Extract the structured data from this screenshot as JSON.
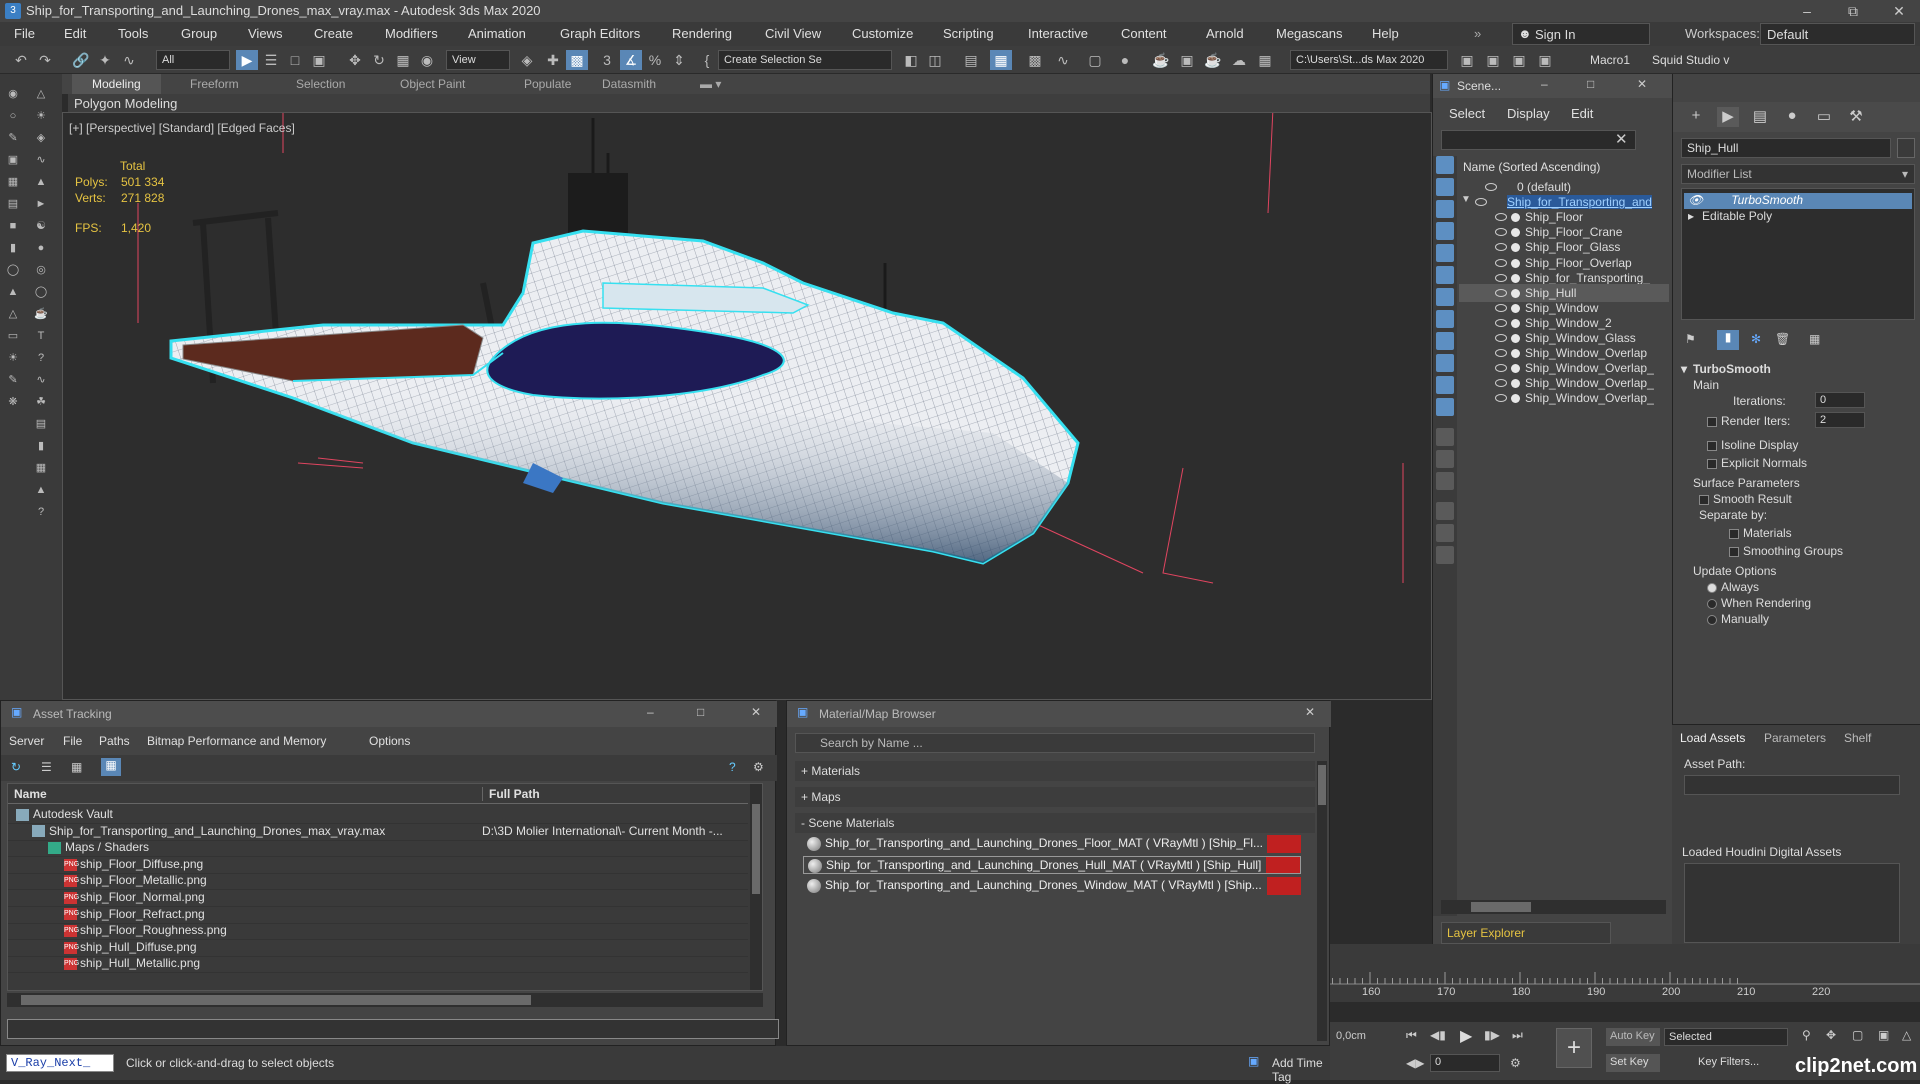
{
  "title": "Ship_for_Transporting_and_Launching_Drones_max_vray.max - Autodesk 3ds Max 2020",
  "menu": [
    "File",
    "Edit",
    "Tools",
    "Group",
    "Views",
    "Create",
    "Modifiers",
    "Animation",
    "Graph Editors",
    "Rendering",
    "Civil View",
    "Customize",
    "Scripting",
    "Interactive",
    "Content",
    "Arnold",
    "Megascans",
    "Help"
  ],
  "signin": "Sign In",
  "workspaces_label": "Workspaces:",
  "workspace": "Default",
  "toolbar": {
    "filter": "All",
    "refcoord": "View",
    "selset": "Create Selection Se",
    "path": "C:\\Users\\St...ds Max 2020",
    "macro": "Macro1",
    "squid": "Squid Studio v"
  },
  "ribbon": {
    "tabs": [
      "Modeling",
      "Freeform",
      "Selection",
      "Object Paint",
      "Populate",
      "Datasmith"
    ],
    "sub": "Polygon Modeling"
  },
  "viewport": {
    "label": "[+] [Perspective] [Standard] [Edged Faces]",
    "total_label": "Total",
    "polys_label": "Polys:",
    "polys": "501 334",
    "verts_label": "Verts:",
    "verts": "271 828",
    "fps_label": "FPS:",
    "fps": "1,420"
  },
  "scene": {
    "title": "Scene...",
    "menu": [
      "Select",
      "Display",
      "Edit"
    ],
    "column": "Name (Sorted Ascending)",
    "rows": [
      "0 (default)",
      "Ship_for_Transporting_and",
      "Ship_Floor",
      "Ship_Floor_Crane",
      "Ship_Floor_Glass",
      "Ship_Floor_Overlap",
      "Ship_for_Transporting_",
      "Ship_Hull",
      "Ship_Window",
      "Ship_Window_2",
      "Ship_Window_Glass",
      "Ship_Window_Overlap",
      "Ship_Window_Overlap_",
      "Ship_Window_Overlap_",
      "Ship_Window_Overlap_"
    ],
    "layer": "Layer Explorer"
  },
  "cmd": {
    "object_name": "Ship_Hull",
    "modifier_list": "Modifier List",
    "stack": [
      "TurboSmooth",
      "Editable Poly"
    ],
    "rollout": "TurboSmooth",
    "main": "Main",
    "iterations_label": "Iterations:",
    "iterations": "0",
    "render_iters_label": "Render Iters:",
    "render_iters": "2",
    "isoline": "Isoline Display",
    "explicit": "Explicit Normals",
    "surface": "Surface Parameters",
    "smooth": "Smooth Result",
    "separate": "Separate by:",
    "materials": "Materials",
    "smoothing": "Smoothing Groups",
    "update": "Update Options",
    "always": "Always",
    "when_render": "When Rendering",
    "manually": "Manually"
  },
  "hda": {
    "tabs": [
      "Load Assets",
      "Parameters",
      "Shelf"
    ],
    "asset_path": "Asset Path:",
    "loaded": "Loaded Houdini Digital Assets"
  },
  "asset": {
    "title": "Asset Tracking",
    "menu": [
      "Server",
      "File",
      "Paths",
      "Bitmap Performance and Memory",
      "Options"
    ],
    "col_name": "Name",
    "col_path": "Full Path",
    "rows": [
      {
        "name": "Autodesk Vault",
        "path": "",
        "indent": 1
      },
      {
        "name": "Ship_for_Transporting_and_Launching_Drones_max_vray.max",
        "path": "D:\\3D Molier International\\- Current Month -...",
        "indent": 2
      },
      {
        "name": "Maps / Shaders",
        "path": "",
        "indent": 3
      },
      {
        "name": "ship_Floor_Diffuse.png",
        "path": "",
        "indent": 4
      },
      {
        "name": "ship_Floor_Metallic.png",
        "path": "",
        "indent": 4
      },
      {
        "name": "ship_Floor_Normal.png",
        "path": "",
        "indent": 4
      },
      {
        "name": "ship_Floor_Refract.png",
        "path": "",
        "indent": 4
      },
      {
        "name": "ship_Floor_Roughness.png",
        "path": "",
        "indent": 4
      },
      {
        "name": "ship_Hull_Diffuse.png",
        "path": "",
        "indent": 4
      },
      {
        "name": "ship_Hull_Metallic.png",
        "path": "",
        "indent": 4
      }
    ]
  },
  "matb": {
    "title": "Material/Map Browser",
    "search": "Search by Name ...",
    "materials": "+ Materials",
    "maps": "+ Maps",
    "scene_materials": "- Scene Materials",
    "items": [
      "Ship_for_Transporting_and_Launching_Drones_Floor_MAT ( VRayMtl ) [Ship_Fl...",
      "Ship_for_Transporting_and_Launching_Drones_Hull_MAT ( VRayMtl ) [Ship_Hull]",
      "Ship_for_Transporting_and_Launching_Drones_Window_MAT ( VRayMtl ) [Ship..."
    ]
  },
  "timeline": {
    "ticks": [
      "160",
      "170",
      "180",
      "190",
      "200",
      "210",
      "220"
    ],
    "pos": "0,0cm"
  },
  "anim": {
    "auto_key": "Auto Key",
    "set_key": "Set Key",
    "selected": "Selected",
    "key_filters": "Key Filters...",
    "frame": "0"
  },
  "status": {
    "script": "V_Ray_Next_",
    "prompt": "Click or click-and-drag to select objects",
    "add_tag": "Add Time Tag"
  },
  "watermark": "clip2net.com",
  "colors": {
    "accent": "#5a87b6",
    "stats": "#e5c342",
    "wire_selected": "#36e0f0",
    "hull_dark": "#1e1b55"
  }
}
